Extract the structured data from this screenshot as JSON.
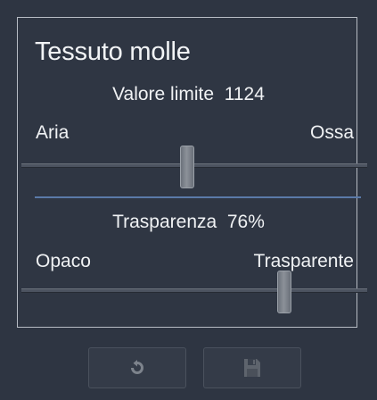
{
  "panel": {
    "title": "Tessuto molle",
    "threshold": {
      "label": "Valore limite",
      "value": "1124",
      "min_label": "Aria",
      "max_label": "Ossa",
      "slider_fraction": 0.48
    },
    "transparency": {
      "label": "Trasparenza",
      "value": "76%",
      "min_label": "Opaco",
      "max_label": "Trasparente",
      "slider_fraction": 0.76
    }
  },
  "toolbar": {
    "reset_icon": "reset-icon",
    "save_icon": "save-icon"
  },
  "colors": {
    "background": "#2e3542",
    "border": "#b7bcc4",
    "accent_line": "#5a7aa8",
    "text": "#f0f2f4"
  }
}
